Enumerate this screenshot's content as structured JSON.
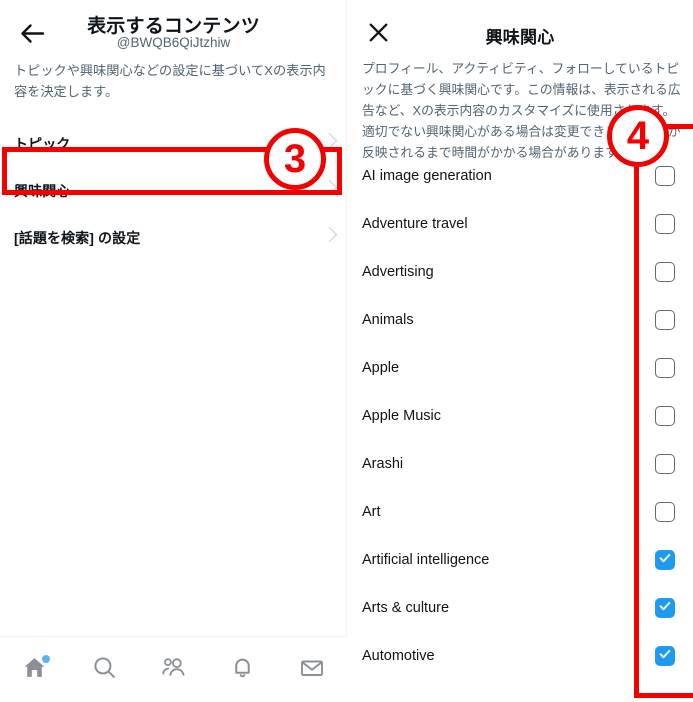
{
  "left_panel": {
    "back_icon": "arrow-left-icon",
    "title": "表示するコンテンツ",
    "handle": "@BWQB6QiJtzhiw",
    "description": "トピックや興味関心などの設定に基づいてXの表示内容を決定します。",
    "menu_items": [
      {
        "label": "トピック",
        "chevron": "chevron-right-icon"
      },
      {
        "label": "興味関心",
        "chevron": "chevron-right-icon"
      },
      {
        "label": "[話題を検索] の設定",
        "chevron": "chevron-right-icon"
      }
    ]
  },
  "right_panel": {
    "close_icon": "close-icon",
    "title": "興味関心",
    "description": "プロフィール、アクティビティ、フォローしているトピックに基づく興味関心です。この情報は、表示される広告など、Xの表示内容のカスタマイズに使用されます。適切でない興味関心がある場合は変更できます。変更が反映されるまで時間がかかる場合があります。",
    "interests": [
      {
        "label": "AI image generation",
        "checked": false
      },
      {
        "label": "Adventure travel",
        "checked": false
      },
      {
        "label": "Advertising",
        "checked": false
      },
      {
        "label": "Animals",
        "checked": false
      },
      {
        "label": "Apple",
        "checked": false
      },
      {
        "label": "Apple Music",
        "checked": false
      },
      {
        "label": "Arashi",
        "checked": false
      },
      {
        "label": "Art",
        "checked": false
      },
      {
        "label": "Artificial intelligence",
        "checked": true
      },
      {
        "label": "Arts & culture",
        "checked": true
      },
      {
        "label": "Automotive",
        "checked": true
      }
    ]
  },
  "bottom_nav": {
    "items": [
      {
        "icon": "home-icon",
        "badge": true
      },
      {
        "icon": "search-icon",
        "badge": false
      },
      {
        "icon": "communities-icon",
        "badge": false
      },
      {
        "icon": "notifications-icon",
        "badge": false
      },
      {
        "icon": "messages-icon",
        "badge": false
      }
    ]
  },
  "annotations": {
    "step3": "3",
    "step4": "4"
  },
  "colors": {
    "accent_blue": "#1d9bf0",
    "annotation_red": "#f40000",
    "text_primary": "#0f1419",
    "text_secondary": "#536471"
  }
}
